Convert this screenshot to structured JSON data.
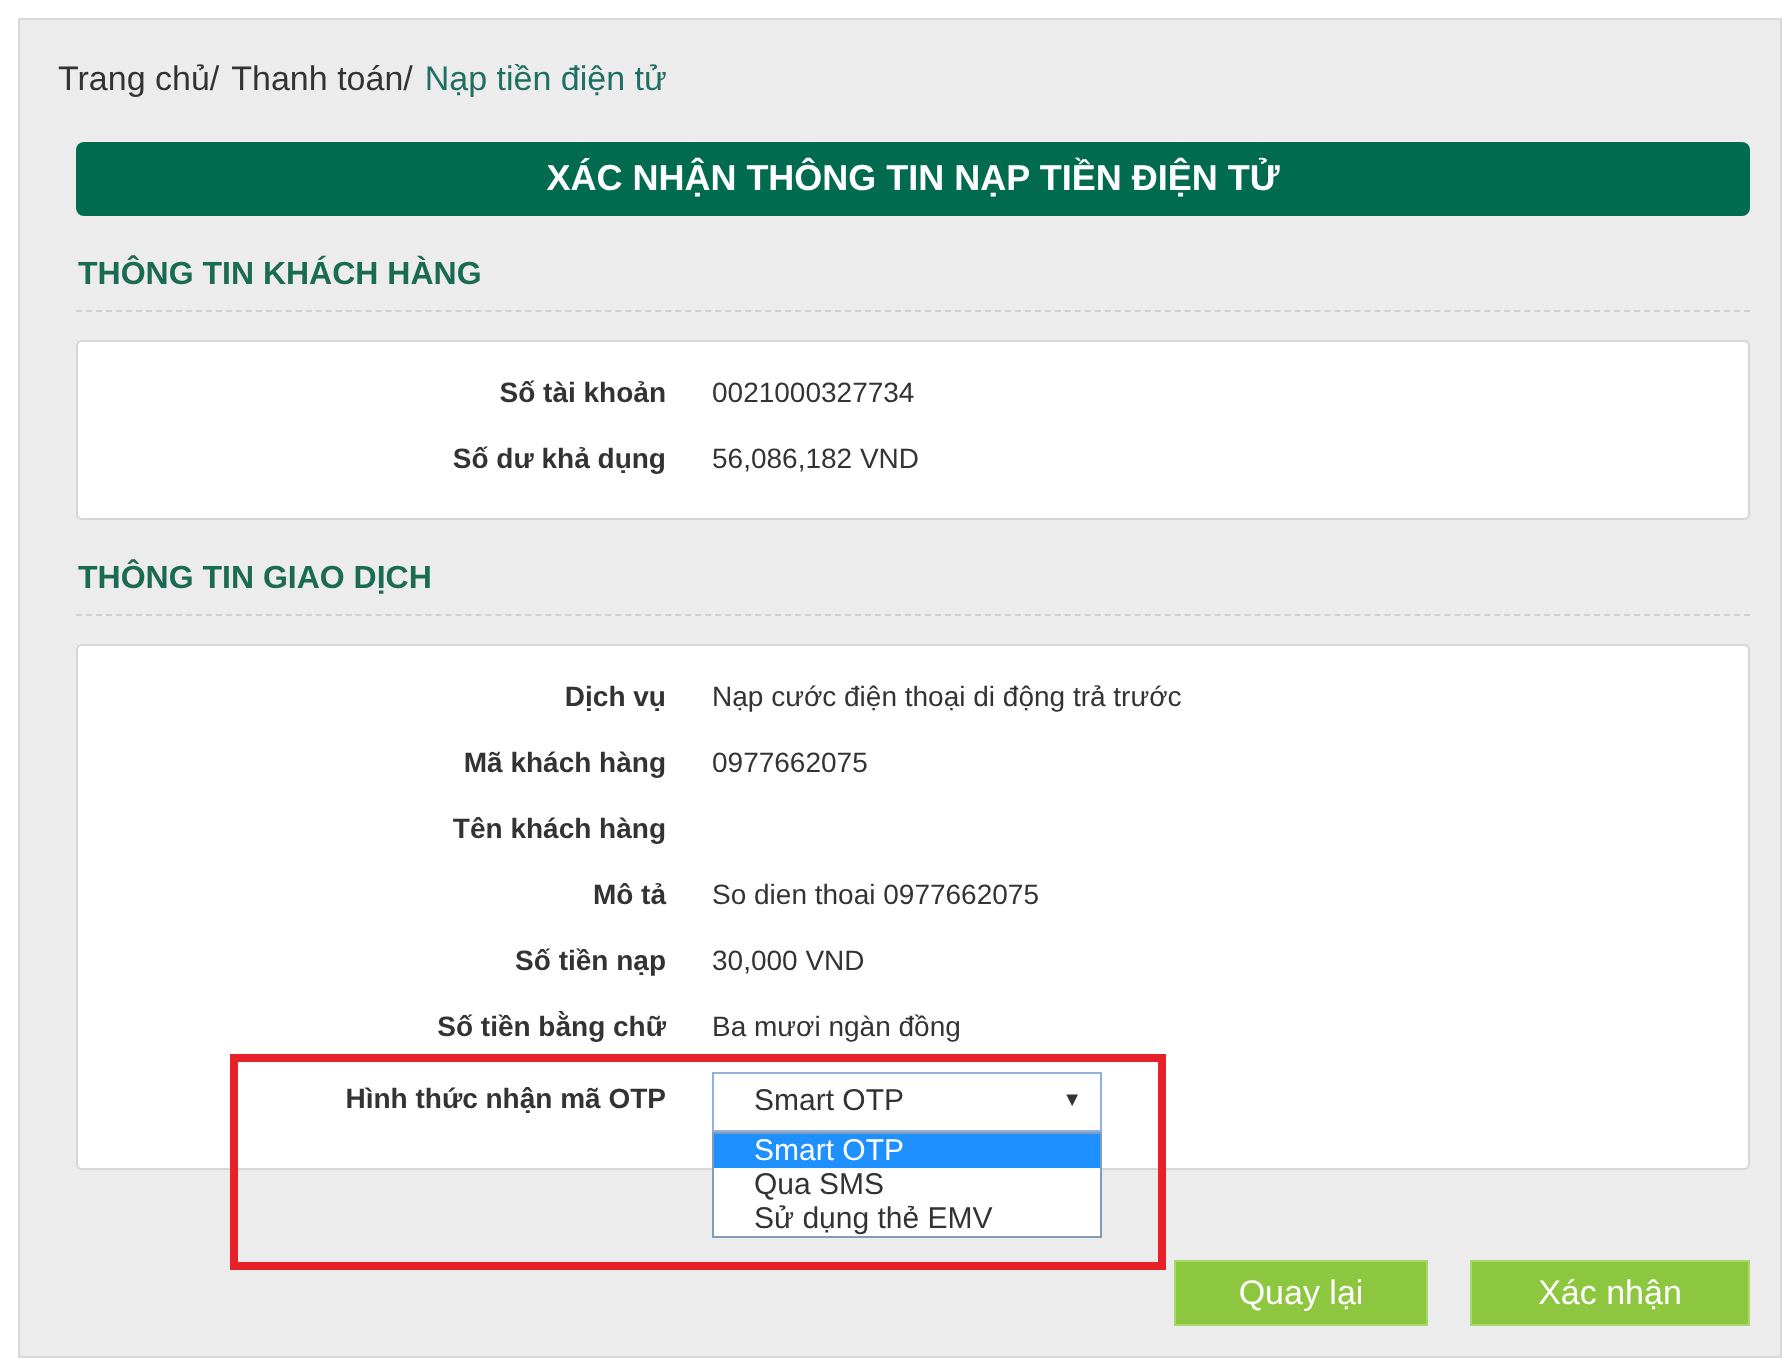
{
  "breadcrumb": [
    {
      "label": "Trang chủ/",
      "current": false
    },
    {
      "label": "Thanh toán/",
      "current": false
    },
    {
      "label": "Nạp tiền điện tử",
      "current": true
    }
  ],
  "title": "XÁC NHẬN THÔNG TIN NẠP TIỀN ĐIỆN TỬ",
  "sections": [
    {
      "heading": "THÔNG TIN KHÁCH HÀNG",
      "rows": [
        {
          "label": "Số tài khoản",
          "value": "0021000327734"
        },
        {
          "label": "Số dư khả dụng",
          "value": "56,086,182 VND"
        }
      ]
    },
    {
      "heading": "THÔNG TIN GIAO DỊCH",
      "rows": [
        {
          "label": "Dịch vụ",
          "value": "Nạp cước điện thoại di động trả trước"
        },
        {
          "label": "Mã khách hàng",
          "value": "0977662075"
        },
        {
          "label": "Tên khách hàng"
        },
        {
          "label": "Mô tả",
          "value": "So dien thoai 0977662075"
        },
        {
          "label": "Số tiền nạp",
          "value": "30,000 VND"
        },
        {
          "label": "Số tiền bằng chữ",
          "value": "Ba mươi ngàn đồng"
        }
      ],
      "otp": {
        "label": "Hình thức nhận mã OTP",
        "value": "Smart OTP",
        "caret": "▼",
        "expanded": true,
        "options": [
          {
            "label": "Smart OTP",
            "selected": true
          },
          {
            "label": "Qua SMS",
            "selected": false
          },
          {
            "label": "Sử dụng thẻ EMV",
            "selected": false
          }
        ]
      }
    }
  ],
  "buttons": [
    "Quay lại",
    "Xác nhận"
  ]
}
